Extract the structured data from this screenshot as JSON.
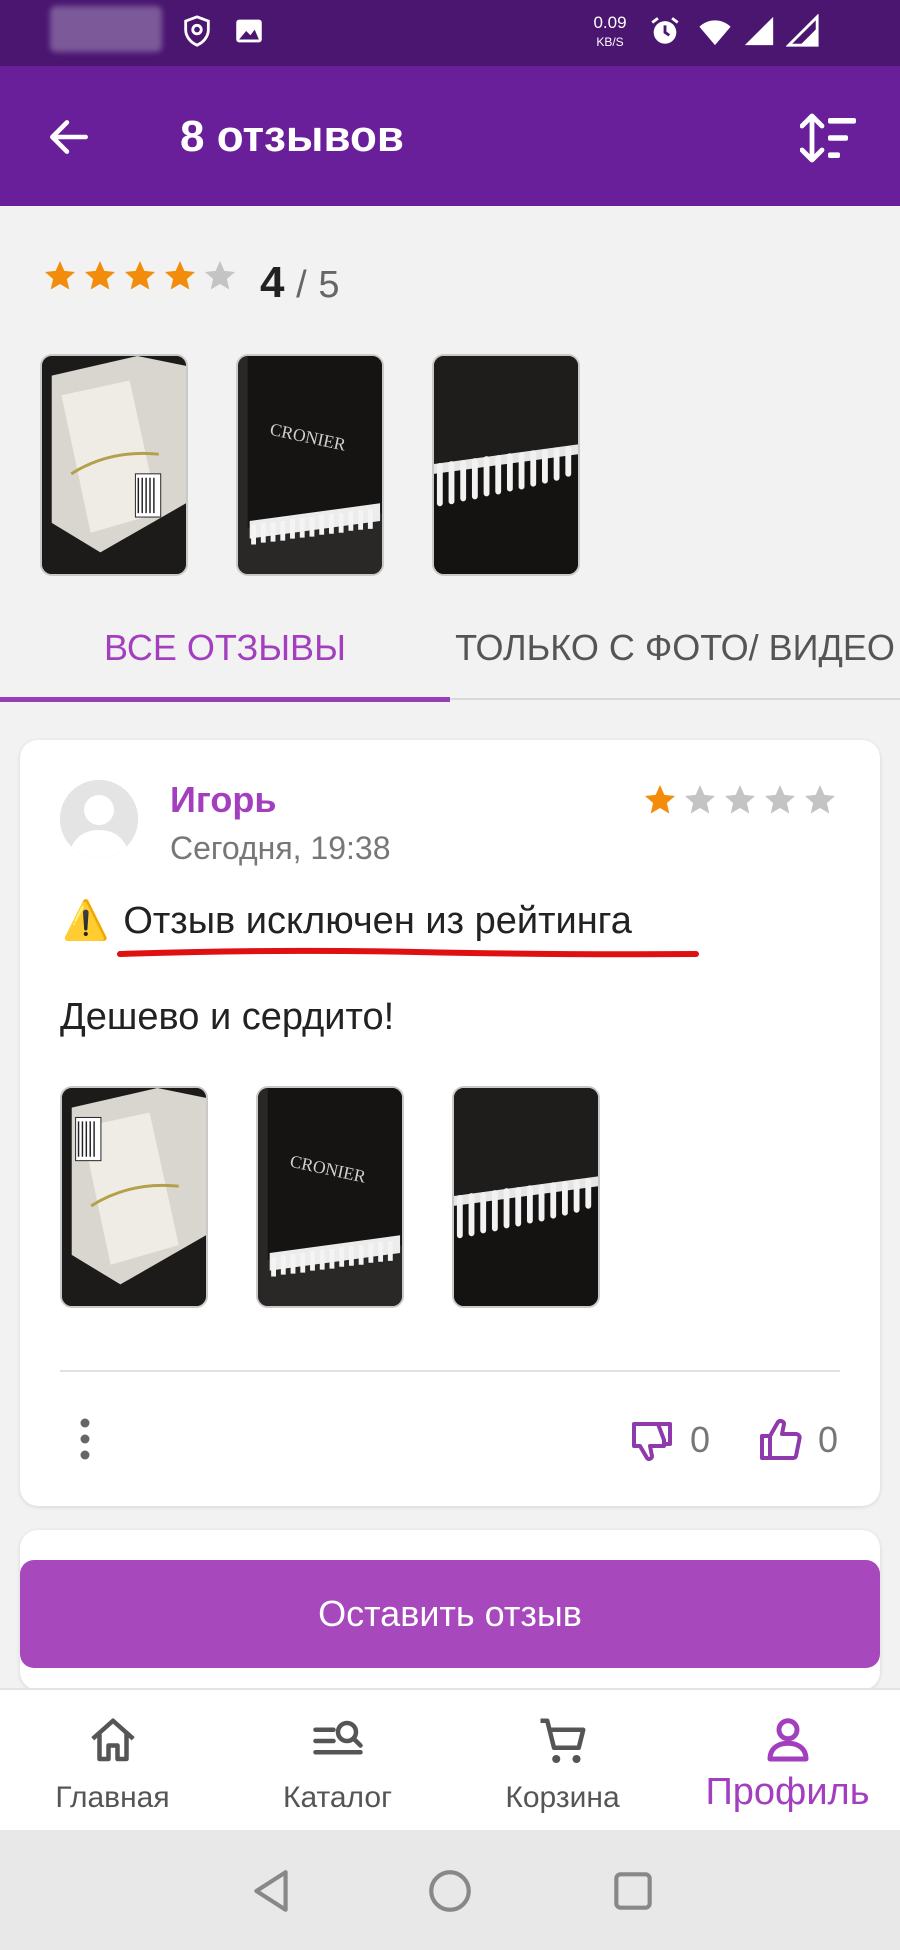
{
  "status_bar": {
    "net_speed": "0.09",
    "net_unit": "KB/S"
  },
  "header": {
    "title": "8 отзывов"
  },
  "summary": {
    "rating": "4",
    "rating_max": "5",
    "rating_sep": "/",
    "stars_filled": 4,
    "stars_total": 5
  },
  "tabs": [
    {
      "label": "ВСЕ ОТЗЫВЫ",
      "active": true
    },
    {
      "label": "ТОЛЬКО С ФОТО/ ВИДЕО",
      "active": false
    }
  ],
  "review": {
    "author": "Игорь",
    "date": "Сегодня, 19:38",
    "stars_filled": 1,
    "stars_total": 5,
    "warning_icon": "⚠️",
    "warning": "Отзыв исключен из рейтинга",
    "text": "Дешево и сердито!",
    "dislikes": "0",
    "likes": "0"
  },
  "leave_review_button": "Оставить отзыв",
  "bottom_nav": [
    {
      "label": "Главная",
      "icon": "home-icon",
      "active": false
    },
    {
      "label": "Каталог",
      "icon": "catalog-search-icon",
      "active": false
    },
    {
      "label": "Корзина",
      "icon": "cart-icon",
      "active": false
    },
    {
      "label": "Профиль",
      "icon": "profile-icon",
      "active": true
    }
  ],
  "colors": {
    "status_bar": "#4a1670",
    "app_bar": "#6a1f9a",
    "accent": "#a33fbf",
    "button": "#a748bd",
    "star": "#f38c0a",
    "star_empty": "#c4c4c4"
  }
}
